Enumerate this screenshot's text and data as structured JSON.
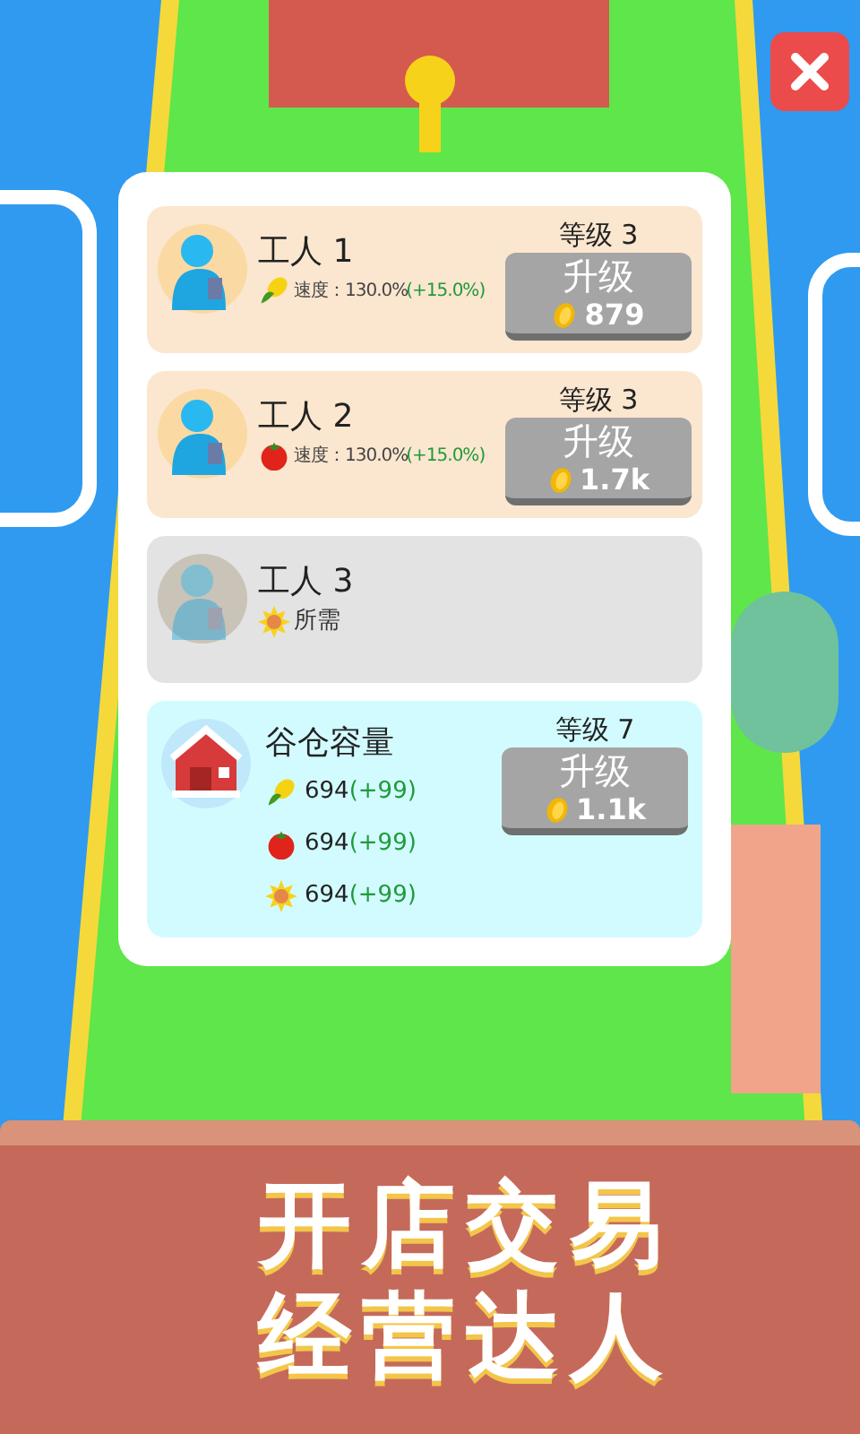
{
  "workers": [
    {
      "name": "工人 1",
      "locked": false,
      "crop": {
        "kind": "corn"
      },
      "speed": "速度：130.0%",
      "bonus": "(+15.0%)",
      "level": "等级 3",
      "upgrade": "升级",
      "cost": "879"
    },
    {
      "name": "工人 2",
      "locked": false,
      "crop": {
        "kind": "tomato"
      },
      "speed": "速度：130.0%",
      "bonus": "(+15.0%)",
      "level": "等级 3",
      "upgrade": "升级",
      "cost": "1.7k"
    },
    {
      "name": "工人 3",
      "locked": true,
      "crop": {
        "kind": "sunflower"
      },
      "requirement": "所需"
    }
  ],
  "barn": {
    "title": "谷仓容量",
    "level": "等级 7",
    "upgrade": "升级",
    "cost": "1.1k",
    "stocks": [
      {
        "kind": "corn",
        "amount": "694",
        "bonus": "(+99)"
      },
      {
        "kind": "tomato",
        "amount": "694",
        "bonus": "(+99)"
      },
      {
        "kind": "sunflower",
        "amount": "694",
        "bonus": "(+99)"
      }
    ]
  },
  "banner": {
    "lines": [
      "开店交易",
      "经营达人"
    ]
  }
}
